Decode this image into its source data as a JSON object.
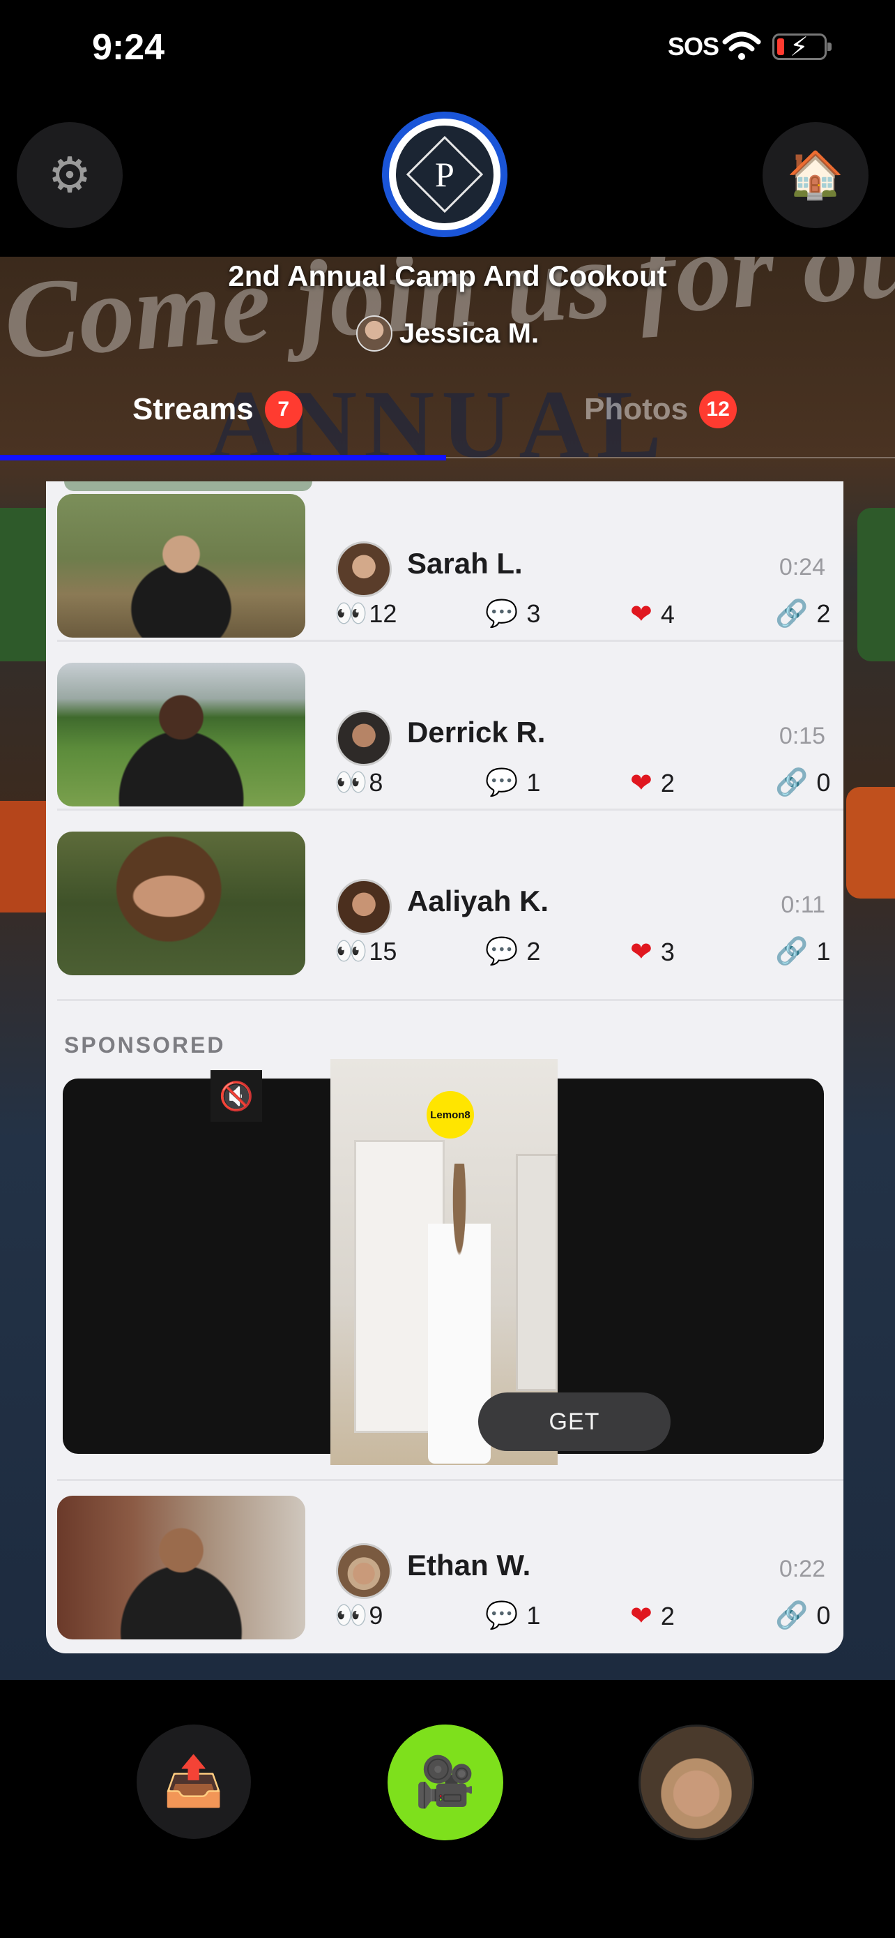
{
  "status_bar": {
    "time": "9:24",
    "carrier": "SOS"
  },
  "header": {
    "logo_letter": "P",
    "event_title": "2nd Annual Camp And Cookout",
    "host_name": "Jessica M."
  },
  "banner": {
    "deco_text": "Come join us for our",
    "deco_text2": "ANNUAL"
  },
  "tabs": [
    {
      "label": "Streams",
      "count": "7",
      "active": true
    },
    {
      "label": "Photos",
      "count": "12",
      "active": false
    }
  ],
  "streams": [
    {
      "name": "Sarah L.",
      "duration": "0:24",
      "views": "12",
      "comments": "3",
      "likes": "4",
      "shares": "2"
    },
    {
      "name": "Derrick R.",
      "duration": "0:15",
      "views": "8",
      "comments": "1",
      "likes": "2",
      "shares": "0"
    },
    {
      "name": "Aaliyah K.",
      "duration": "0:11",
      "views": "15",
      "comments": "2",
      "likes": "3",
      "shares": "1"
    },
    {
      "name": "Ethan W.",
      "duration": "0:22",
      "views": "9",
      "comments": "1",
      "likes": "2",
      "shares": "0"
    }
  ],
  "sponsored": {
    "label": "SPONSORED",
    "brand": "Lemon8",
    "cta": "GET"
  },
  "icons": {
    "settings": "gear-icon",
    "home": "house-icon",
    "inbox": "inbox-tray-icon",
    "record": "video-camera-icon",
    "views": "eyes-icon",
    "comments": "speech-bubble-icon",
    "likes": "heart-icon",
    "shares": "link-icon",
    "mute": "speaker-muted-icon"
  },
  "colors": {
    "accent_blue": "#1212ff",
    "badge_red": "#ff3b30",
    "record_green": "#7ee01c",
    "heart_red": "#e0171f"
  }
}
